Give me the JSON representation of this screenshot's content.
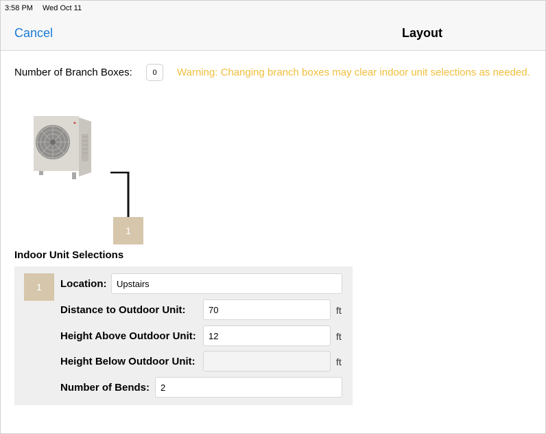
{
  "status_bar": {
    "time": "3:58 PM",
    "date": "Wed Oct 11"
  },
  "nav": {
    "cancel_label": "Cancel",
    "title": "Layout"
  },
  "branch": {
    "label": "Number of Branch Boxes:",
    "value": "0",
    "warning": "Warning: Changing branch boxes may clear indoor unit selections as needed."
  },
  "diagram": {
    "outdoor_unit_icon": "outdoor-ac-unit-icon",
    "indoor_unit_number": "1"
  },
  "indoor_selections": {
    "title": "Indoor Unit Selections",
    "unit_number": "1",
    "location": {
      "label": "Location:",
      "value": "Upstairs"
    },
    "distance": {
      "label": "Distance to Outdoor Unit:",
      "value": "70",
      "unit": "ft"
    },
    "height_above": {
      "label": "Height Above Outdoor Unit:",
      "value": "12",
      "unit": "ft"
    },
    "height_below": {
      "label": "Height Below Outdoor Unit:",
      "value": "",
      "unit": "ft"
    },
    "bends": {
      "label": "Number of Bends:",
      "value": "2"
    }
  },
  "colors": {
    "accent": "#1a7ad8",
    "warning": "#f2be3b",
    "badge": "#d6c6ab",
    "panel": "#efefef"
  }
}
